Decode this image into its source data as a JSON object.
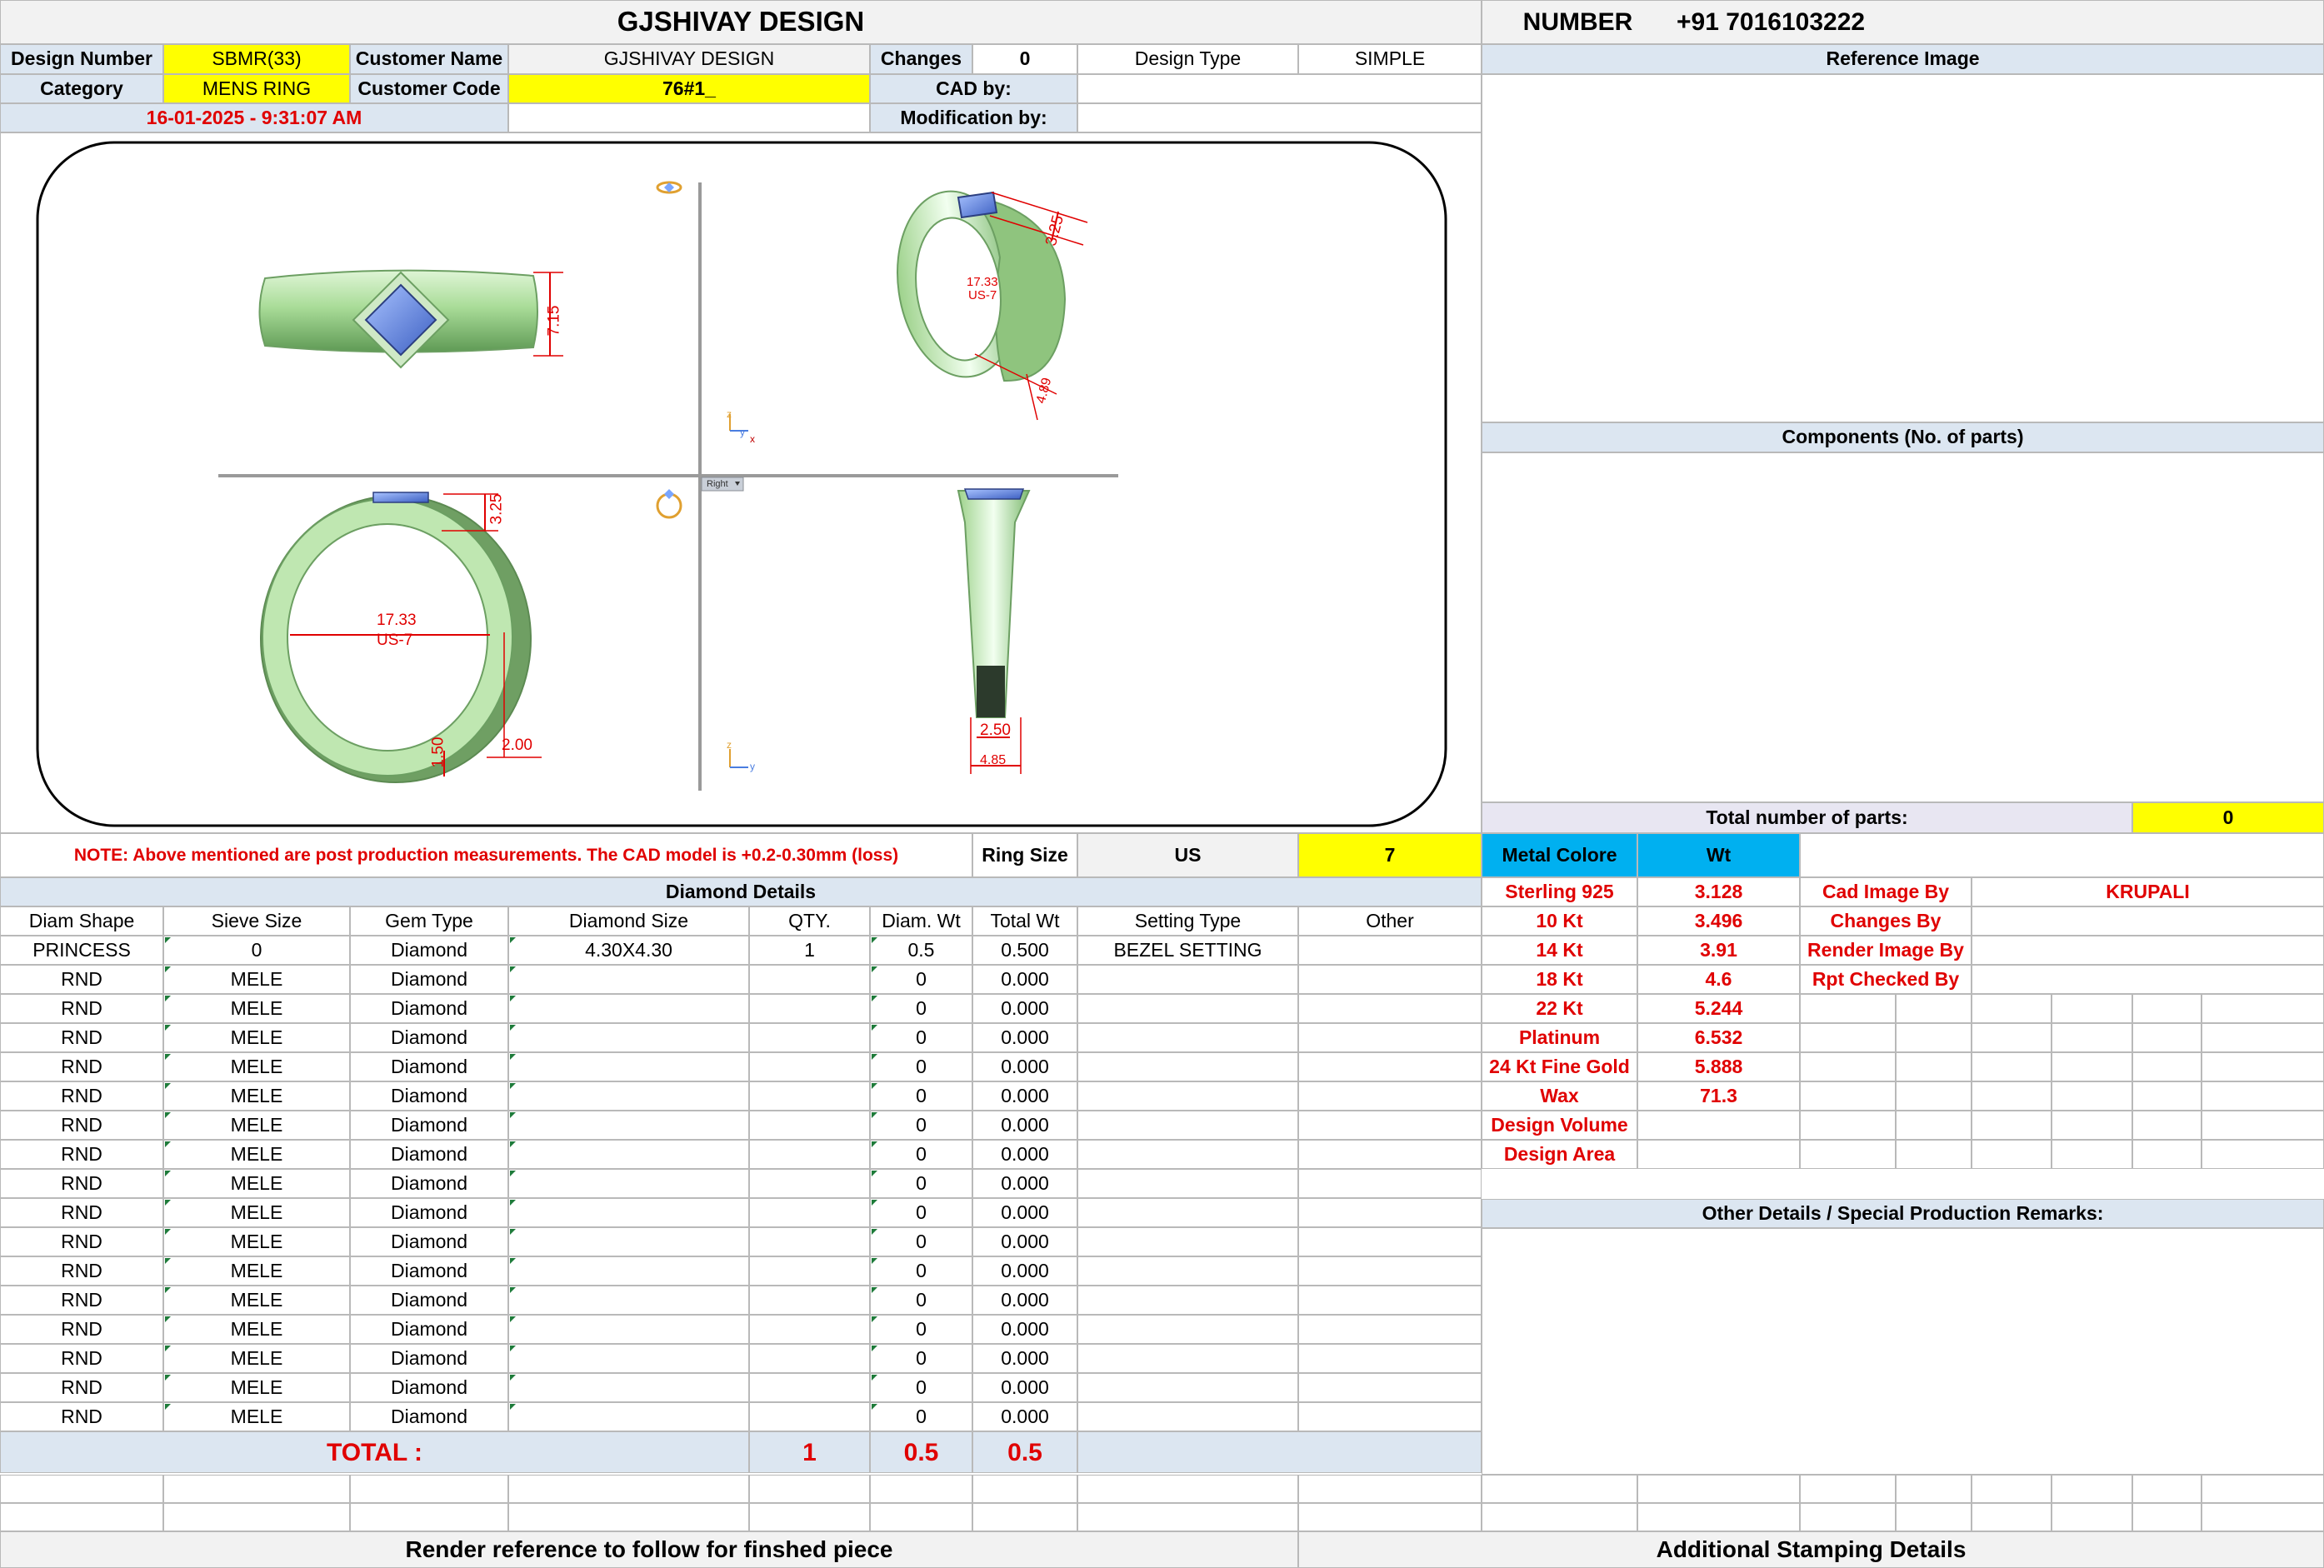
{
  "header": {
    "title": "GJSHIVAY DESIGN",
    "number_label": "NUMBER",
    "number_value": "+91 7016103222"
  },
  "info": {
    "design_number_label": "Design Number",
    "design_number": "SBMR(33)",
    "customer_name_label": "Customer Name",
    "customer_name": "GJSHIVAY DESIGN",
    "changes_label": "Changes",
    "changes": "0",
    "design_type_label": "Design Type",
    "design_type": "SIMPLE",
    "category_label": "Category",
    "category": "MENS RING",
    "customer_code_label": "Customer Code",
    "customer_code": "76#1_",
    "cad_by_label": "CAD by:",
    "cad_by": "",
    "modification_by_label": "Modification by:",
    "modification_by": "",
    "date": "16-01-2025 - 9:31:07 AM"
  },
  "panels": {
    "reference_image": "Reference Image",
    "components": "Components (No. of parts)",
    "total_parts_label": "Total number of parts:",
    "total_parts": "0",
    "other_details": "Other Details / Special Production Remarks:"
  },
  "cad": {
    "top_height": "7.15",
    "iso_height": "3.25",
    "iso_inner": "17.33",
    "iso_size": "US-7",
    "iso_width": "4.89",
    "front_height": "3.25",
    "front_inner": "17.33",
    "front_size": "US-7",
    "front_thickness": "1.50",
    "front_side": "2.00",
    "side_bottom": "2.50",
    "side_top": "4.85",
    "view_label": "Right",
    "axis_x": "x",
    "axis_y": "y",
    "axis_z": "z"
  },
  "note": "NOTE: Above mentioned are post production measurements. The CAD model is +0.2-0.30mm (loss)",
  "ring": {
    "label": "Ring Size",
    "system": "US",
    "size": "7"
  },
  "metal": {
    "color_label": "Metal Colore",
    "wt_label": "Wt",
    "rows": [
      {
        "name": "Sterling 925",
        "wt": "3.128"
      },
      {
        "name": "10 Kt",
        "wt": "3.496"
      },
      {
        "name": "14 Kt",
        "wt": "3.91"
      },
      {
        "name": "18 Kt",
        "wt": "4.6"
      },
      {
        "name": "22 Kt",
        "wt": "5.244"
      },
      {
        "name": "Platinum",
        "wt": "6.532"
      },
      {
        "name": "24 Kt Fine Gold",
        "wt": "5.888"
      },
      {
        "name": "Wax",
        "wt": "71.3"
      },
      {
        "name": "Design Volume",
        "wt": ""
      },
      {
        "name": "Design Area",
        "wt": ""
      }
    ]
  },
  "credits": {
    "rows": [
      {
        "label": "Cad Image By",
        "value": "KRUPALI"
      },
      {
        "label": "Changes By",
        "value": ""
      },
      {
        "label": "Render Image By",
        "value": ""
      },
      {
        "label": "Rpt Checked By",
        "value": ""
      }
    ]
  },
  "diamonds": {
    "title": "Diamond Details",
    "columns": [
      "Diam Shape",
      "Sieve Size",
      "Gem Type",
      "Diamond Size",
      "QTY.",
      "Diam. Wt",
      "Total Wt",
      "Setting Type",
      "Other"
    ],
    "rows": [
      [
        "PRINCESS",
        "0",
        "Diamond",
        "4.30X4.30",
        "1",
        "0.5",
        "0.500",
        "BEZEL SETTING",
        ""
      ],
      [
        "RND",
        "MELE",
        "Diamond",
        "",
        "",
        "0",
        "0.000",
        "",
        ""
      ],
      [
        "RND",
        "MELE",
        "Diamond",
        "",
        "",
        "0",
        "0.000",
        "",
        ""
      ],
      [
        "RND",
        "MELE",
        "Diamond",
        "",
        "",
        "0",
        "0.000",
        "",
        ""
      ],
      [
        "RND",
        "MELE",
        "Diamond",
        "",
        "",
        "0",
        "0.000",
        "",
        ""
      ],
      [
        "RND",
        "MELE",
        "Diamond",
        "",
        "",
        "0",
        "0.000",
        "",
        ""
      ],
      [
        "RND",
        "MELE",
        "Diamond",
        "",
        "",
        "0",
        "0.000",
        "",
        ""
      ],
      [
        "RND",
        "MELE",
        "Diamond",
        "",
        "",
        "0",
        "0.000",
        "",
        ""
      ],
      [
        "RND",
        "MELE",
        "Diamond",
        "",
        "",
        "0",
        "0.000",
        "",
        ""
      ],
      [
        "RND",
        "MELE",
        "Diamond",
        "",
        "",
        "0",
        "0.000",
        "",
        ""
      ],
      [
        "RND",
        "MELE",
        "Diamond",
        "",
        "",
        "0",
        "0.000",
        "",
        ""
      ],
      [
        "RND",
        "MELE",
        "Diamond",
        "",
        "",
        "0",
        "0.000",
        "",
        ""
      ],
      [
        "RND",
        "MELE",
        "Diamond",
        "",
        "",
        "0",
        "0.000",
        "",
        ""
      ],
      [
        "RND",
        "MELE",
        "Diamond",
        "",
        "",
        "0",
        "0.000",
        "",
        ""
      ],
      [
        "RND",
        "MELE",
        "Diamond",
        "",
        "",
        "0",
        "0.000",
        "",
        ""
      ],
      [
        "RND",
        "MELE",
        "Diamond",
        "",
        "",
        "0",
        "0.000",
        "",
        ""
      ],
      [
        "RND",
        "MELE",
        "Diamond",
        "",
        "",
        "0",
        "0.000",
        "",
        ""
      ]
    ],
    "total_label": "TOTAL :",
    "total_qty": "1",
    "total_diam_wt": "0.5",
    "total_wt": "0.5"
  },
  "footer": {
    "render_note": "Render reference to follow for finshed piece",
    "stamping": "Additional Stamping Details"
  },
  "colors": {
    "highlight_yellow": "#ffff00",
    "header_blue": "#dce6f1",
    "metal_header": "#00b0f0",
    "metal_green": "#b5e3a7",
    "stone_blue": "#5b7fd6",
    "dimension_red": "#e00000"
  }
}
